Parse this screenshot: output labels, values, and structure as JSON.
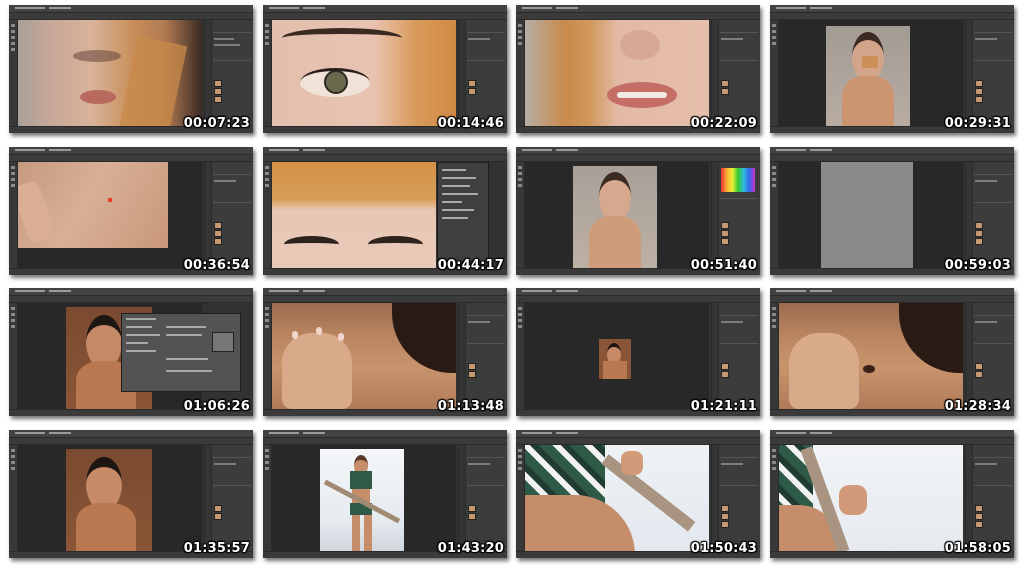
{
  "thumbnails": [
    {
      "time": "00:07:23"
    },
    {
      "time": "00:14:46"
    },
    {
      "time": "00:22:09"
    },
    {
      "time": "00:29:31"
    },
    {
      "time": "00:36:54"
    },
    {
      "time": "00:44:17"
    },
    {
      "time": "00:51:40"
    },
    {
      "time": "00:59:03"
    },
    {
      "time": "01:06:26"
    },
    {
      "time": "01:13:48"
    },
    {
      "time": "01:21:11"
    },
    {
      "time": "01:28:34"
    },
    {
      "time": "01:35:57"
    },
    {
      "time": "01:43:20"
    },
    {
      "time": "01:50:43"
    },
    {
      "time": "01:58:05"
    }
  ]
}
